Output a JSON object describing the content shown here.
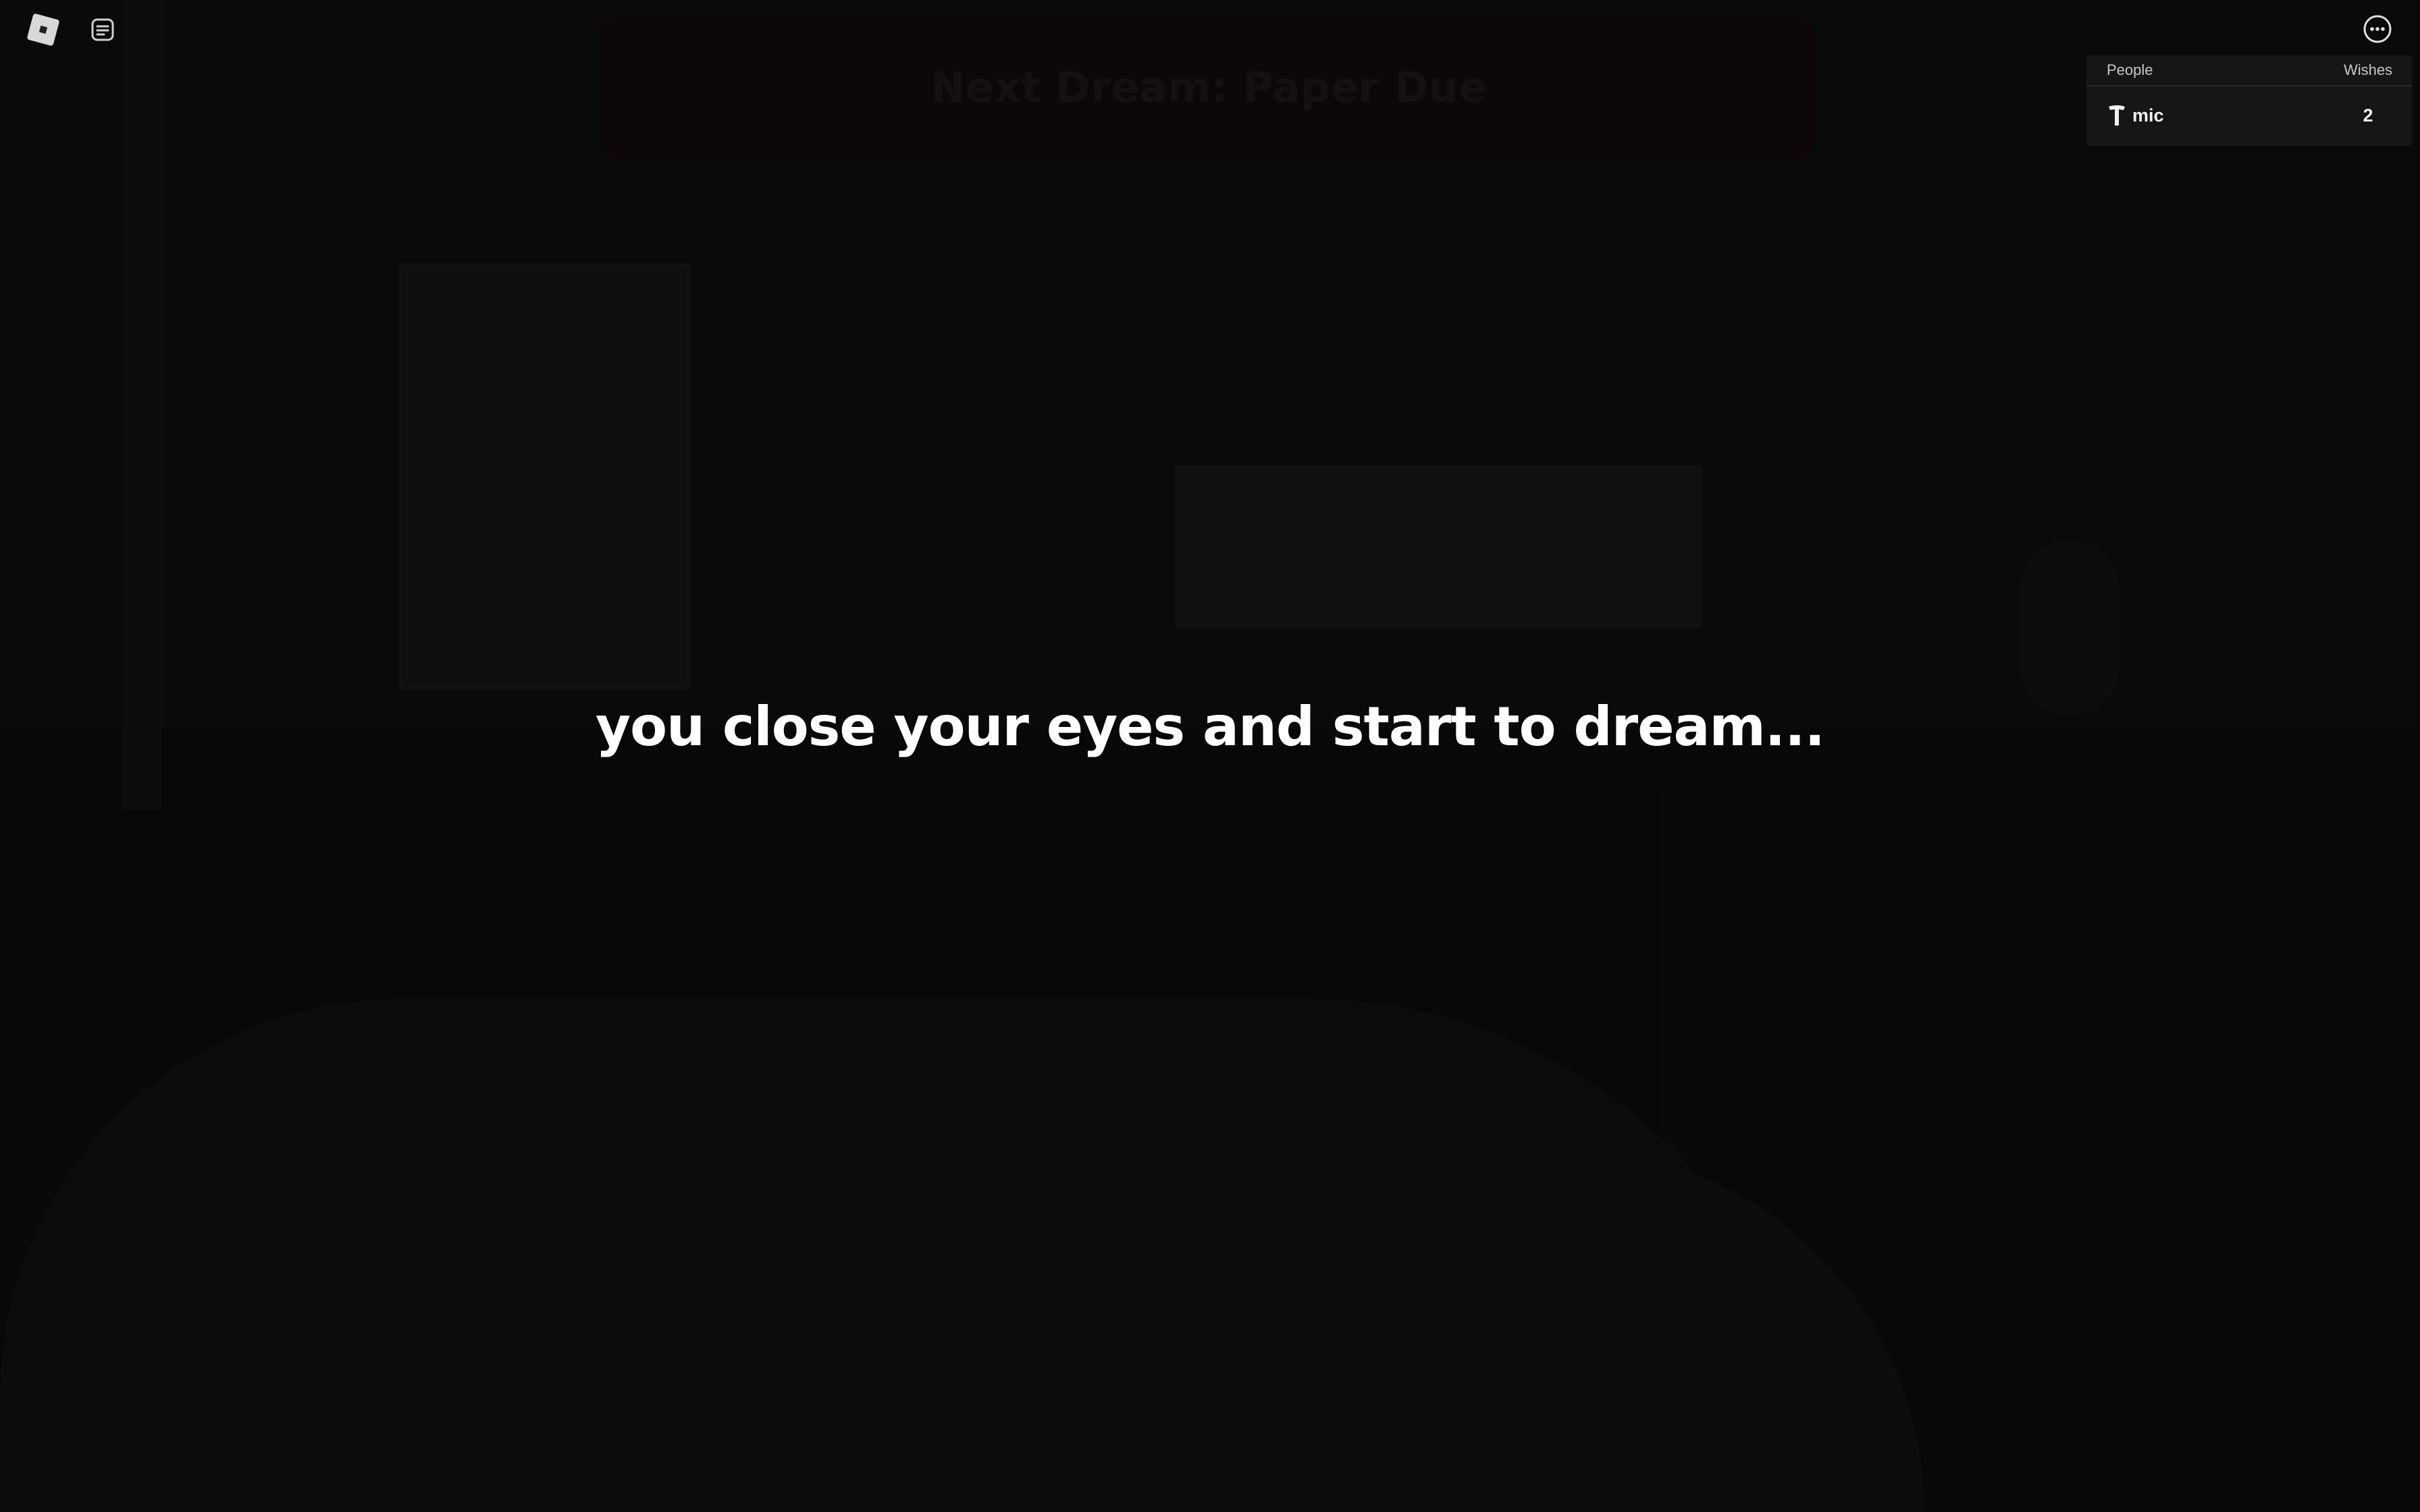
{
  "scene": {
    "banner_text": "Next Dream: Paper Due",
    "side_text": "",
    "message": "you close your eyes and start to dream..."
  },
  "topbar": {
    "menu_icon": "roblox-logo-icon",
    "chat_icon": "chat-icon",
    "more_icon": "more-options-icon"
  },
  "leaderboard": {
    "columns": [
      "People",
      "Wishes"
    ],
    "players": [
      {
        "name": "mic",
        "wishes": "2",
        "badge_icon": "premium-badge-icon"
      }
    ]
  },
  "colors": {
    "background": "#0a0a0a",
    "leaderboard_bg": "#161616",
    "message_text": "#ffffff",
    "banner_bg": "#0e0707"
  }
}
